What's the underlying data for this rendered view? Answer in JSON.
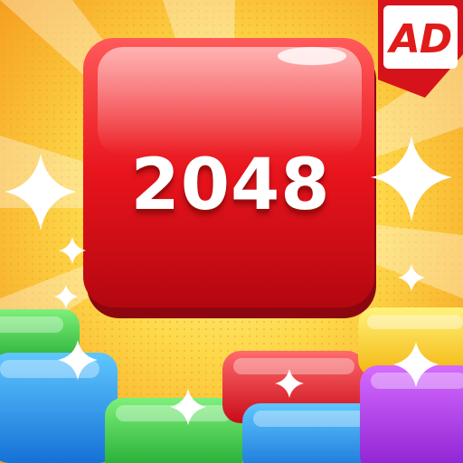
{
  "game": {
    "main_tile": {
      "value": "2048",
      "color": "#e0161d"
    },
    "ad_badge": {
      "label": "AD",
      "color": "#e11a1a"
    }
  },
  "background": {
    "color_center": "#fde95a",
    "color_edge": "#f7a21b"
  },
  "bottom_blocks": [
    {
      "color": "green"
    },
    {
      "color": "blue"
    },
    {
      "color": "green"
    },
    {
      "color": "red"
    },
    {
      "color": "blue"
    },
    {
      "color": "yellow"
    },
    {
      "color": "purple"
    }
  ]
}
